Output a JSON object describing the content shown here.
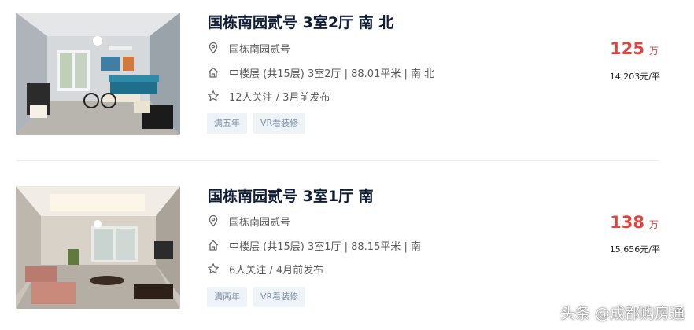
{
  "listings": [
    {
      "title": "国栋南园贰号 3室2厅 南 北",
      "community": "国栋南园贰号",
      "house_info": "中楼层 (共15层) 3室2厅 | 88.01平米 | 南 北",
      "follow_info": "12人关注 / 3月前发布",
      "tags": [
        "满五年",
        "VR看装修"
      ],
      "total_price": "125",
      "price_unit": "万",
      "unit_price": "14,203元/平",
      "icons": [
        "location-icon",
        "home-icon",
        "star-icon"
      ]
    },
    {
      "title": "国栋南园贰号 3室1厅 南",
      "community": "国栋南园贰号",
      "house_info": "中楼层 (共15层) 3室1厅 | 88.15平米 | 南",
      "follow_info": "6人关注 / 4月前发布",
      "tags": [
        "满两年",
        "VR看装修"
      ],
      "total_price": "138",
      "price_unit": "万",
      "unit_price": "15,656元/平",
      "icons": [
        "location-icon",
        "home-icon",
        "star-icon"
      ]
    }
  ],
  "watermark": "头条 @成都购房通",
  "colors": {
    "title": "#101d37",
    "price": "#e0443e",
    "tag_bg": "#eef3f8",
    "tag_text": "#7f8fa6"
  }
}
